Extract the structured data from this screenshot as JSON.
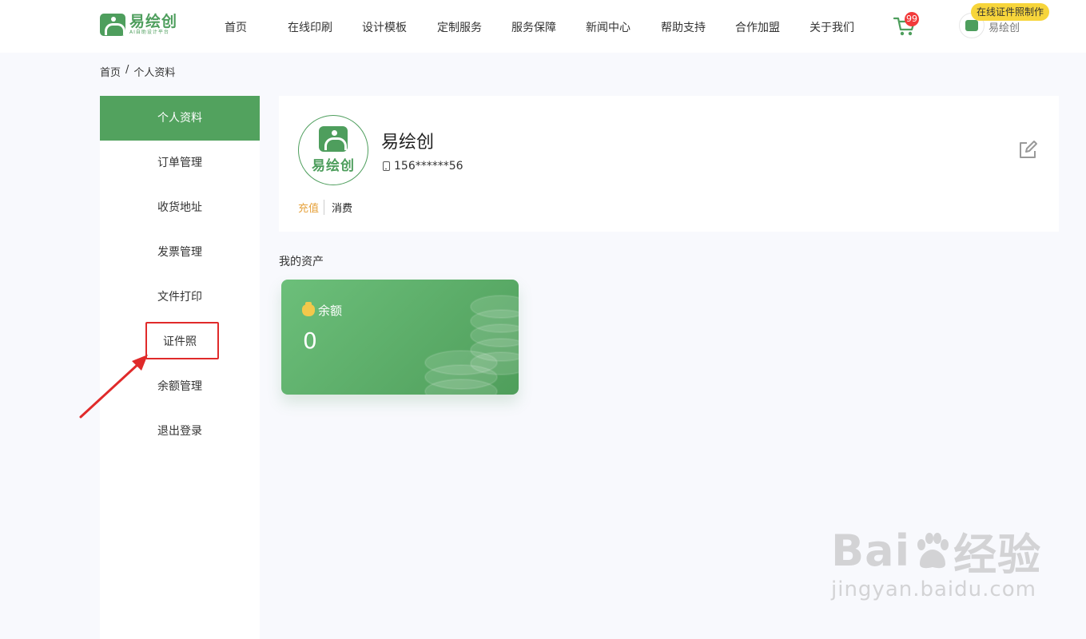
{
  "header": {
    "logo_name": "易绘创",
    "logo_sub": "AI自助设计平台",
    "nav": [
      "首页",
      "在线印刷",
      "设计模板",
      "定制服务",
      "服务保障",
      "新闻中心",
      "帮助支持",
      "合作加盟",
      "关于我们"
    ],
    "cart_count": "99",
    "user_name": "易绘创",
    "promo": "在线证件照制作"
  },
  "breadcrumb": {
    "home": "首页",
    "separator": "/",
    "current": "个人资料"
  },
  "sidebar": {
    "items": [
      {
        "label": "个人资料"
      },
      {
        "label": "订单管理"
      },
      {
        "label": "收货地址"
      },
      {
        "label": "发票管理"
      },
      {
        "label": "文件打印"
      },
      {
        "label": "证件照"
      },
      {
        "label": "余额管理"
      },
      {
        "label": "退出登录"
      }
    ]
  },
  "profile": {
    "avatar_text": "易绘创",
    "name": "易绘创",
    "phone": "156******56",
    "tab_recharge": "充值",
    "tab_consume": "消费"
  },
  "assets": {
    "title": "我的资产",
    "balance_label": "余额",
    "balance_value": "0"
  },
  "watermark": {
    "main_a": "Bai",
    "main_b": "经验",
    "sub": "jingyan.baidu.com"
  },
  "colors": {
    "brand": "#4e9e5d",
    "active_sidebar": "#52a25e",
    "highlight": "#e02a2a",
    "recharge": "#e6a23c",
    "promo": "#f7d53b"
  }
}
